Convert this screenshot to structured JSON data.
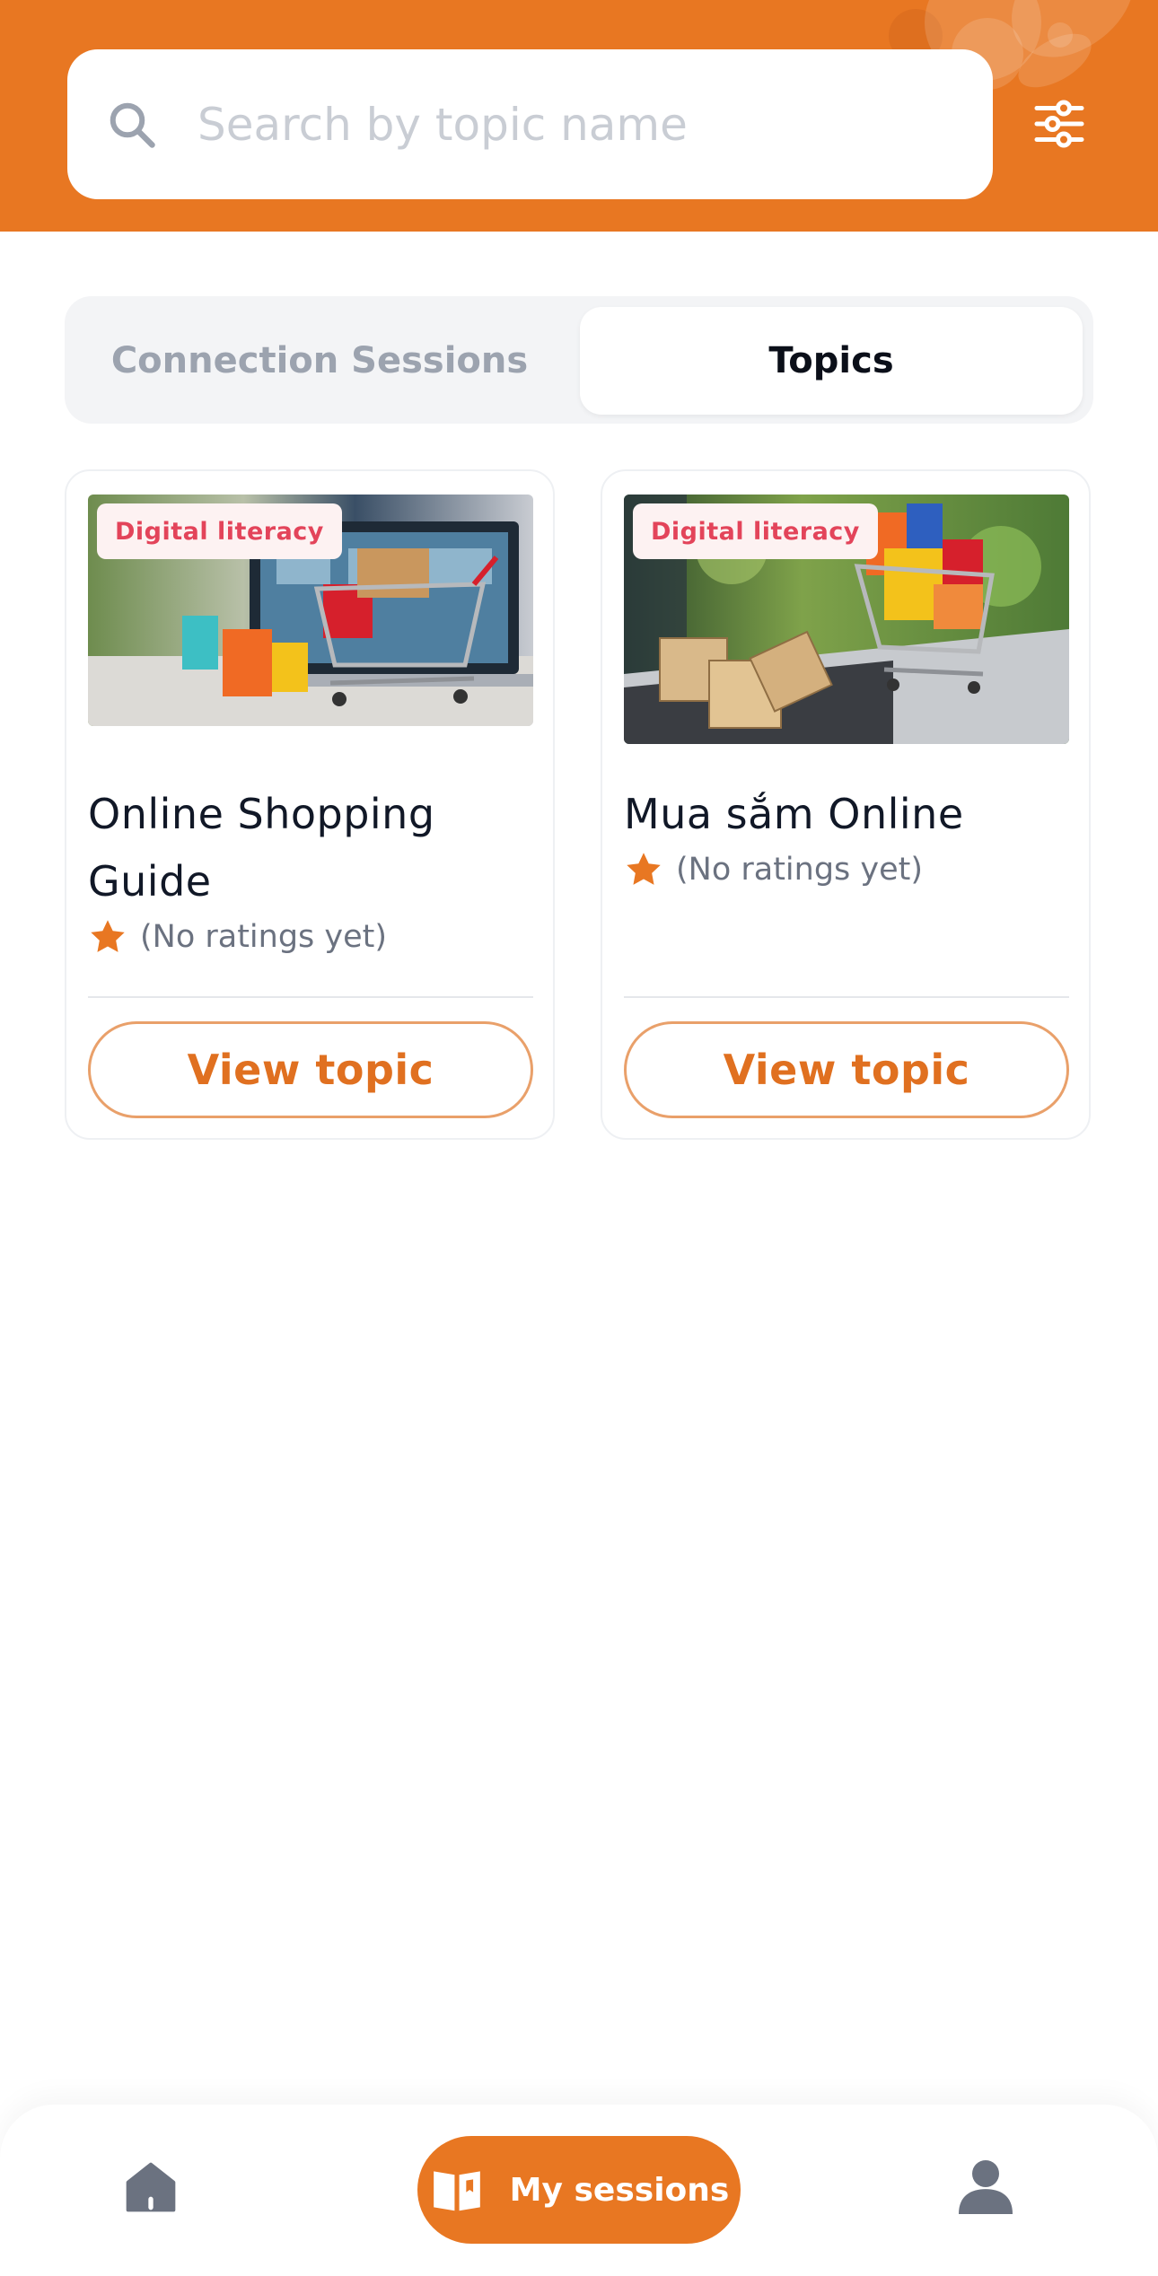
{
  "header": {
    "search": {
      "placeholder": "Search by topic name",
      "value": ""
    },
    "icons": {
      "search": "search-icon",
      "filter": "sliders-icon"
    }
  },
  "tabs": [
    {
      "label": "Connection Sessions",
      "active": false
    },
    {
      "label": "Topics",
      "active": true
    }
  ],
  "topics": [
    {
      "category": "Digital literacy",
      "title": "Online Shopping Guide",
      "rating_text": "(No ratings yet)",
      "button_label": "View topic"
    },
    {
      "category": "Digital literacy",
      "title": "Mua sắm Online",
      "rating_text": "(No ratings yet)",
      "button_label": "View topic"
    }
  ],
  "bottom_nav": {
    "items": [
      {
        "icon": "home-icon",
        "label": ""
      },
      {
        "icon": "book-open-icon",
        "label": "My sessions",
        "active": true
      },
      {
        "icon": "user-icon",
        "label": ""
      }
    ]
  },
  "colors": {
    "brand_orange": "#E87722",
    "badge_text": "#E3445A",
    "star": "#E87722"
  }
}
